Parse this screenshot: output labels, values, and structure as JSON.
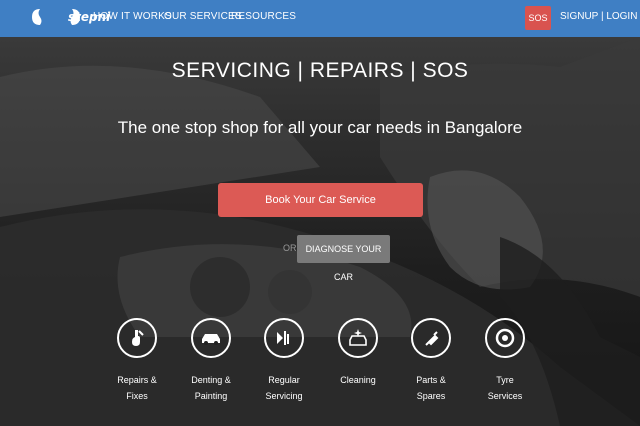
{
  "brand": {
    "logo_text": "stepni"
  },
  "nav": {
    "items": [
      "HOW IT WORKS",
      "OUR SERVICES",
      "RESOURCES"
    ],
    "sos": "SOS",
    "auth": "SIGNUP | LOGIN"
  },
  "hero": {
    "headline": "SERVICING | REPAIRS | SOS",
    "subline": "The one stop shop for all your car needs in Bangalore",
    "book_button": "Book Your Car Service",
    "or": "OR",
    "diagnose_button": "DIAGNOSE YOUR CAR"
  },
  "services": [
    {
      "line1": "Repairs &",
      "line2": "Fixes",
      "icon": "wrench-hand-icon"
    },
    {
      "line1": "Denting &",
      "line2": "Painting",
      "icon": "car-icon"
    },
    {
      "line1": "Regular",
      "line2": "Servicing",
      "icon": "service-tools-icon"
    },
    {
      "line1": "Cleaning",
      "line2": "",
      "icon": "sparkle-car-icon"
    },
    {
      "line1": "Parts &",
      "line2": "Spares",
      "icon": "spark-plug-icon"
    },
    {
      "line1": "Tyre",
      "line2": "Services",
      "icon": "tyre-icon"
    }
  ],
  "colors": {
    "topbar": "#3f7fc4",
    "accent": "#dc5a55",
    "sos": "#d9534f",
    "secondary_button": "#7a7a7a"
  }
}
